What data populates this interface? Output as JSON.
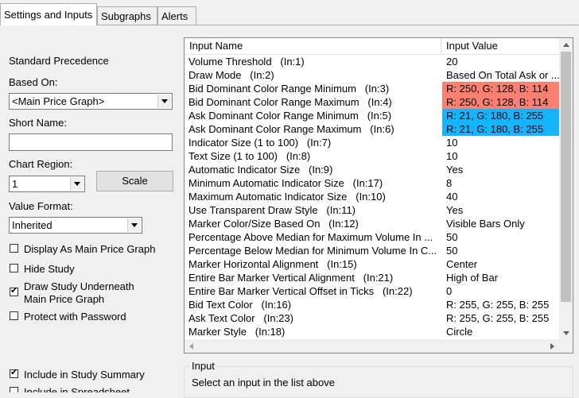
{
  "tabs": [
    {
      "label": "Settings and Inputs",
      "active": true
    },
    {
      "label": "Subgraphs",
      "active": false
    },
    {
      "label": "Alerts",
      "active": false
    }
  ],
  "left": {
    "standard_precedence": "Standard Precedence",
    "based_on_label": "Based On:",
    "based_on_value": "<Main Price Graph>",
    "short_name_label": "Short Name:",
    "short_name_value": "",
    "chart_region_label": "Chart Region:",
    "chart_region_value": "1",
    "scale_button": "Scale",
    "value_format_label": "Value Format:",
    "value_format_value": "Inherited",
    "checkboxes": [
      {
        "label": "Display As Main Price Graph",
        "checked": false
      },
      {
        "label": "Hide Study",
        "checked": false
      },
      {
        "label": "Draw Study Underneath",
        "label2": "Main Price Graph",
        "checked": true
      },
      {
        "label": "Protect with Password",
        "checked": false
      },
      {
        "label": "Include in Study Summary",
        "checked": true
      },
      {
        "label": "Include in Spreadsheet",
        "checked": false
      }
    ]
  },
  "inputs_list": {
    "col_name": "Input Name",
    "col_value": "Input Value",
    "rows": [
      {
        "name": "Volume Threshold   (In:1)",
        "value": "20",
        "bg": ""
      },
      {
        "name": "Draw Mode   (In:2)",
        "value": "Based On Total Ask or ...",
        "bg": ""
      },
      {
        "name": "Bid Dominant Color Range Minimum   (In:3)",
        "value": "R: 250, G: 128, B: 114",
        "bg": "#fa8072"
      },
      {
        "name": "Bid Dominant Color Range Maximum   (In:4)",
        "value": "R: 250, G: 128, B: 114",
        "bg": "#fa8072"
      },
      {
        "name": "Ask Dominant Color Range Minimum   (In:5)",
        "value": "R: 21, G: 180, B: 255",
        "bg": "#15b4ff"
      },
      {
        "name": "Ask Dominant Color Range Maximum   (In:6)",
        "value": "R: 21, G: 180, B: 255",
        "bg": "#15b4ff"
      },
      {
        "name": "Indicator Size (1 to 100)   (In:7)",
        "value": "10",
        "bg": ""
      },
      {
        "name": "Text Size (1 to 100)   (In:8)",
        "value": "10",
        "bg": ""
      },
      {
        "name": "Automatic Indicator Size   (In:9)",
        "value": "Yes",
        "bg": ""
      },
      {
        "name": "Minimum Automatic Indicator Size   (In:17)",
        "value": "8",
        "bg": ""
      },
      {
        "name": "Maximum Automatic Indicator Size   (In:10)",
        "value": "40",
        "bg": ""
      },
      {
        "name": "Use Transparent Draw Style   (In:11)",
        "value": "Yes",
        "bg": ""
      },
      {
        "name": "Marker Color/Size Based On   (In:12)",
        "value": "Visible Bars Only",
        "bg": ""
      },
      {
        "name": "Percentage Above Median for Maximum Volume In ...",
        "value": "50",
        "bg": ""
      },
      {
        "name": "Percentage Below Median for Minimum Volume In C...",
        "value": "50",
        "bg": ""
      },
      {
        "name": "Marker Horizontal Alignment   (In:15)",
        "value": "Center",
        "bg": ""
      },
      {
        "name": "Entire Bar Marker Vertical Alignment   (In:21)",
        "value": "High of Bar",
        "bg": ""
      },
      {
        "name": "Entire Bar Marker Vertical Offset in Ticks   (In:22)",
        "value": "0",
        "bg": ""
      },
      {
        "name": "Bid Text Color   (In:16)",
        "value": "R: 255, G: 255, B: 255",
        "bg": ""
      },
      {
        "name": "Ask Text Color   (In:23)",
        "value": "R: 255, G: 255, B: 255",
        "bg": ""
      },
      {
        "name": "Marker Style   (In:18)",
        "value": "Circle",
        "bg": ""
      }
    ]
  },
  "input_group": {
    "legend": "Input",
    "hint": "Select an input in the list above"
  }
}
